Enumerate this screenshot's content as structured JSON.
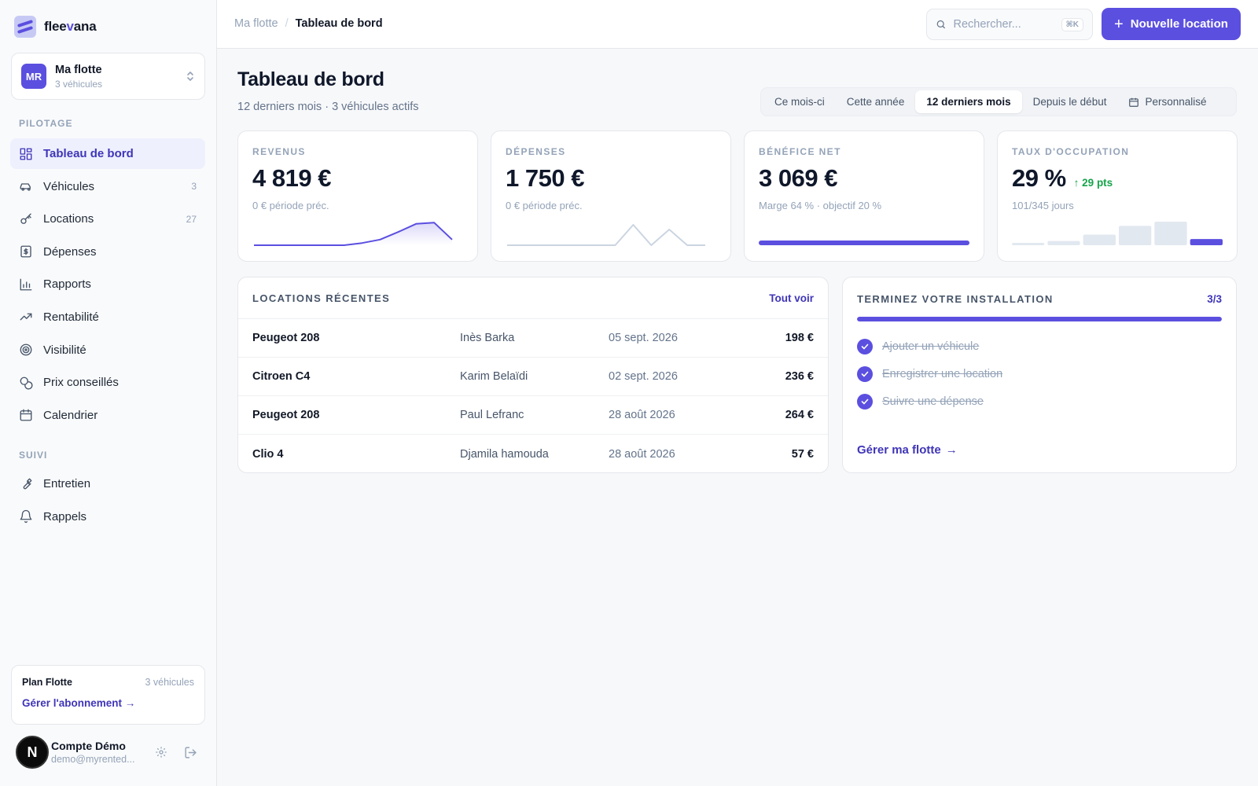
{
  "brand": {
    "name_part1": "flee",
    "name_part2": "v",
    "name_part3": "ana"
  },
  "fleet": {
    "initials": "MR",
    "name": "Ma flotte",
    "sub": "3 véhicules"
  },
  "sidebar": {
    "section_pilotage": "PILOTAGE",
    "pilotage_items": [
      {
        "label": "Tableau de bord",
        "icon": "dashboard-icon",
        "count": ""
      },
      {
        "label": "Véhicules",
        "icon": "car-icon",
        "count": "3"
      },
      {
        "label": "Locations",
        "icon": "key-icon",
        "count": "27"
      },
      {
        "label": "Dépenses",
        "icon": "receipt-icon",
        "count": ""
      },
      {
        "label": "Rapports",
        "icon": "bar-chart-icon",
        "count": ""
      },
      {
        "label": "Rentabilité",
        "icon": "trending-up-icon",
        "count": ""
      },
      {
        "label": "Visibilité",
        "icon": "target-icon",
        "count": ""
      },
      {
        "label": "Prix conseillés",
        "icon": "coins-icon",
        "count": ""
      },
      {
        "label": "Calendrier",
        "icon": "calendar-icon",
        "count": ""
      }
    ],
    "section_suivi": "SUIVI",
    "suivi_items": [
      {
        "label": "Entretien",
        "icon": "wrench-icon"
      },
      {
        "label": "Rappels",
        "icon": "bell-icon"
      }
    ]
  },
  "plan": {
    "name": "Plan Flotte",
    "count": "3 véhicules",
    "link": "Gérer l'abonnement →"
  },
  "account": {
    "initial": "N",
    "name": "Compte Démo",
    "email": "demo@myrented..."
  },
  "topbar": {
    "breadcrumb_parent": "Ma flotte",
    "breadcrumb_sep": "/",
    "breadcrumb_current": "Tableau de bord",
    "search_placeholder": "Rechercher...",
    "search_shortcut": "⌘K",
    "new_button": "Nouvelle location",
    "new_button_icon": "+"
  },
  "page": {
    "title": "Tableau de bord",
    "subtitle": "12 derniers mois · 3 véhicules actifs"
  },
  "periods": [
    {
      "label": "Ce mois-ci",
      "active": false
    },
    {
      "label": "Cette année",
      "active": false
    },
    {
      "label": "12 derniers mois",
      "active": true
    },
    {
      "label": "Depuis le début",
      "active": false
    },
    {
      "label": "Personnalisé",
      "active": false,
      "icon": "calendar-icon"
    }
  ],
  "kpis": [
    {
      "label": "REVENUS",
      "value": "4 819 €",
      "delta": "",
      "sub": "0 € période préc.",
      "chart": "area",
      "color": "#5b4fe0"
    },
    {
      "label": "DÉPENSES",
      "value": "1 750 €",
      "delta": "",
      "sub": "0 € période préc.",
      "chart": "line",
      "color": "#cbd5e1"
    },
    {
      "label": "BÉNÉFICE NET",
      "value": "3 069 €",
      "delta": "",
      "sub": "Marge 64 % · objectif 20 %",
      "chart": "progress",
      "progress": 1.0,
      "color": "#5b4fe0"
    },
    {
      "label": "TAUX D'OCCUPATION",
      "value": "29 %",
      "delta": "↑ 29 pts",
      "sub": "101/345 jours",
      "chart": "bars",
      "color": "#5b4fe0"
    }
  ],
  "chart_data": [
    {
      "type": "area",
      "series": [
        {
          "values": [
            0,
            0,
            0,
            0,
            0,
            0,
            0.28,
            0.72,
            1.68,
            2.72,
            2.88,
            0.72
          ]
        }
      ],
      "ylim": [
        0,
        3.2
      ]
    },
    {
      "type": "line",
      "series": [
        {
          "values": [
            0,
            0,
            0,
            0,
            0,
            0,
            0,
            2.6,
            0,
            2.0,
            0,
            0
          ]
        }
      ],
      "ylim": [
        0,
        3.2
      ]
    },
    {
      "type": "bar",
      "series": [
        {
          "values": [
            0.08,
            0.22,
            0.55,
            1.0,
            1.22,
            0.32
          ]
        }
      ],
      "ylim": [
        0,
        1.3
      ]
    }
  ],
  "recent": {
    "title": "LOCATIONS RÉCENTES",
    "link": "Tout voir",
    "rows": [
      {
        "car": "Peugeot 208",
        "client": "Inès Barka",
        "date": "05 sept. 2026",
        "amount": "198 €"
      },
      {
        "car": "Citroen C4",
        "client": "Karim Belaïdi",
        "date": "02 sept. 2026",
        "amount": "236 €"
      },
      {
        "car": "Peugeot 208",
        "client": "Paul Lefranc",
        "date": "28 août 2026",
        "amount": "264 €"
      },
      {
        "car": "Clio 4",
        "client": "Djamila hamouda",
        "date": "28 août 2026",
        "amount": "57 €"
      }
    ]
  },
  "setup": {
    "title": "TERMINEZ VOTRE INSTALLATION",
    "count": "3/3",
    "progress": 1.0,
    "items": [
      "Ajouter un véhicule",
      "Enregistrer une location",
      "Suivre une dépense"
    ],
    "link": "Gérer ma flotte",
    "link_icon": "→"
  }
}
